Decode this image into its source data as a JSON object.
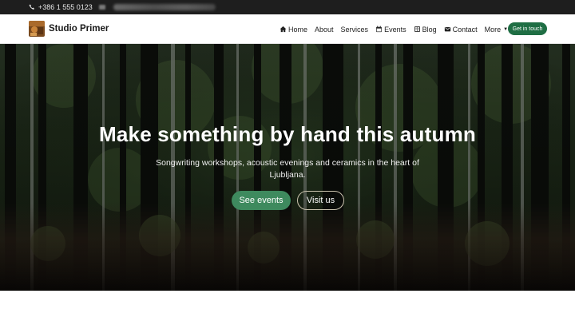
{
  "topbar": {
    "phone": "+386 1 555 0123",
    "phone_icon": "phone-icon",
    "email_icon": "envelope-icon"
  },
  "brand": {
    "name": "Studio Primer",
    "logo_icon": "studio-logo"
  },
  "nav": {
    "items": [
      {
        "label": "Home",
        "icon": "home-icon"
      },
      {
        "label": "About"
      },
      {
        "label": "Services"
      },
      {
        "label": "Events",
        "icon": "calendar-icon"
      },
      {
        "label": "Blog",
        "icon": "book-icon"
      },
      {
        "label": "Contact",
        "icon": "envelope-icon"
      },
      {
        "label": "More",
        "icon": "caret-down-icon"
      }
    ],
    "cta_label": "Get in touch"
  },
  "hero": {
    "title": "Make something by hand this autumn",
    "subtitle": "Songwriting workshops, acoustic evenings and ceramics in the heart of Ljubljana.",
    "primary_button": "See events",
    "secondary_button": "Visit us"
  },
  "colors": {
    "topbar_bg": "#1e1e1e",
    "accent": "#1f6e44",
    "primary_button": "#3e8a5e"
  }
}
